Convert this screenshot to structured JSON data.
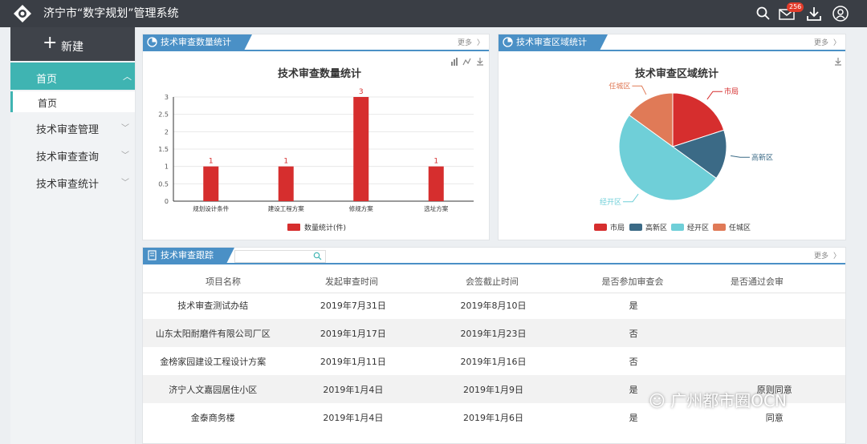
{
  "header": {
    "title": "济宁市“数字规划”管理系统",
    "mail_badge": "256"
  },
  "sidebar": {
    "new_label": "新建",
    "home_label": "首页",
    "home_sub_label": "首页",
    "items": [
      {
        "label": "技术审查管理"
      },
      {
        "label": "技术审查查询"
      },
      {
        "label": "技术审查统计"
      }
    ]
  },
  "bar_panel": {
    "tab_label": "技术审查数量统计",
    "more": "更多"
  },
  "pie_panel": {
    "tab_label": "技术审查区域统计",
    "more": "更多"
  },
  "table_panel": {
    "tab_label": "技术审查跟踪",
    "more": "更多",
    "search_placeholder": "",
    "columns": [
      "项目名称",
      "发起审查时间",
      "会签截止时间",
      "是否参加审查会",
      "是否通过会审"
    ],
    "rows": [
      [
        "技术审查测试办结",
        "2019年7月31日",
        "2019年8月10日",
        "是",
        ""
      ],
      [
        "山东太阳耐磨件有限公司厂区",
        "2019年1月17日",
        "2019年1月23日",
        "否",
        ""
      ],
      [
        "金榜家园建设工程设计方案",
        "2019年1月11日",
        "2019年1月16日",
        "否",
        ""
      ],
      [
        "济宁人文嘉园居住小区",
        "2019年1月4日",
        "2019年1月9日",
        "是",
        "原则同意"
      ],
      [
        "金泰商务楼",
        "2019年1月4日",
        "2019年1月6日",
        "是",
        "同意"
      ]
    ]
  },
  "watermark": "广州都市圈OCN",
  "colors": {
    "accent": "#3fb4b2",
    "tab_blue": "#4a90c6",
    "bar_red": "#d62e2e"
  },
  "chart_data": [
    {
      "type": "bar",
      "title": "技术审查数量统计",
      "categories": [
        "规划设计条件",
        "建设工程方案",
        "修规方案",
        "选址方案"
      ],
      "series": [
        {
          "name": "数量统计(件)",
          "values": [
            1,
            1,
            3,
            1
          ]
        }
      ],
      "yticks": [
        "0",
        "0.5",
        "1",
        "1.5",
        "2",
        "2.5",
        "3"
      ],
      "ylim": [
        0,
        3
      ],
      "grid": true,
      "legend": "bottom"
    },
    {
      "type": "pie",
      "title": "技术审查区域统计",
      "labels": [
        "市局",
        "高新区",
        "经开区",
        "任城区"
      ],
      "values": [
        2,
        1.5,
        5,
        1.5
      ],
      "colors": [
        "#d62e2e",
        "#3b6a86",
        "#6fcfd8",
        "#e07a57"
      ],
      "legend": "bottom"
    }
  ]
}
